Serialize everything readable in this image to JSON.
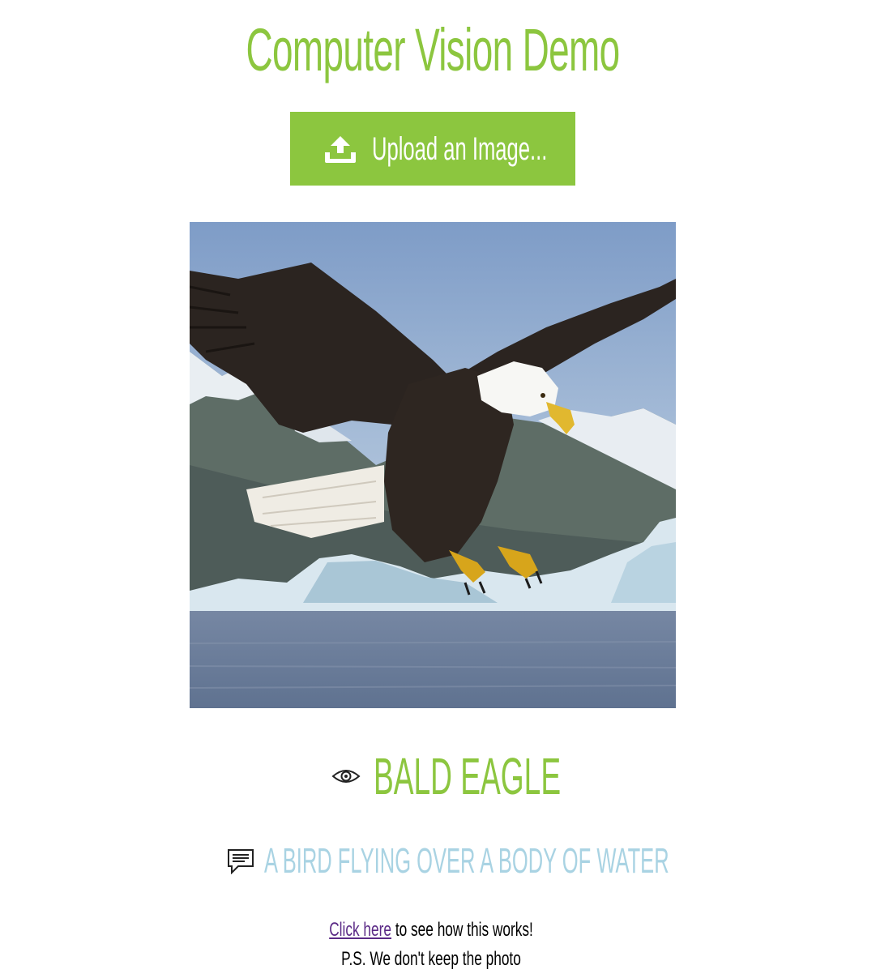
{
  "page": {
    "title": "Computer Vision Demo"
  },
  "upload": {
    "label": "Upload an Image..."
  },
  "result": {
    "tag": "BALD EAGLE",
    "caption": "A BIRD FLYING OVER A BODY OF WATER"
  },
  "footer": {
    "link_text": "Click here",
    "line1_rest": " to see how this works!",
    "line2": "P.S. We don't keep the photo"
  },
  "colors": {
    "accent_green": "#8cc63f",
    "caption_blue": "#a9d3e3",
    "link_purple": "#5b2a86",
    "icon_dark": "#222222"
  },
  "icons": {
    "upload": "upload-icon",
    "eye": "eye-icon",
    "caption": "comment-icon"
  },
  "image": {
    "subject": "bald eagle"
  }
}
